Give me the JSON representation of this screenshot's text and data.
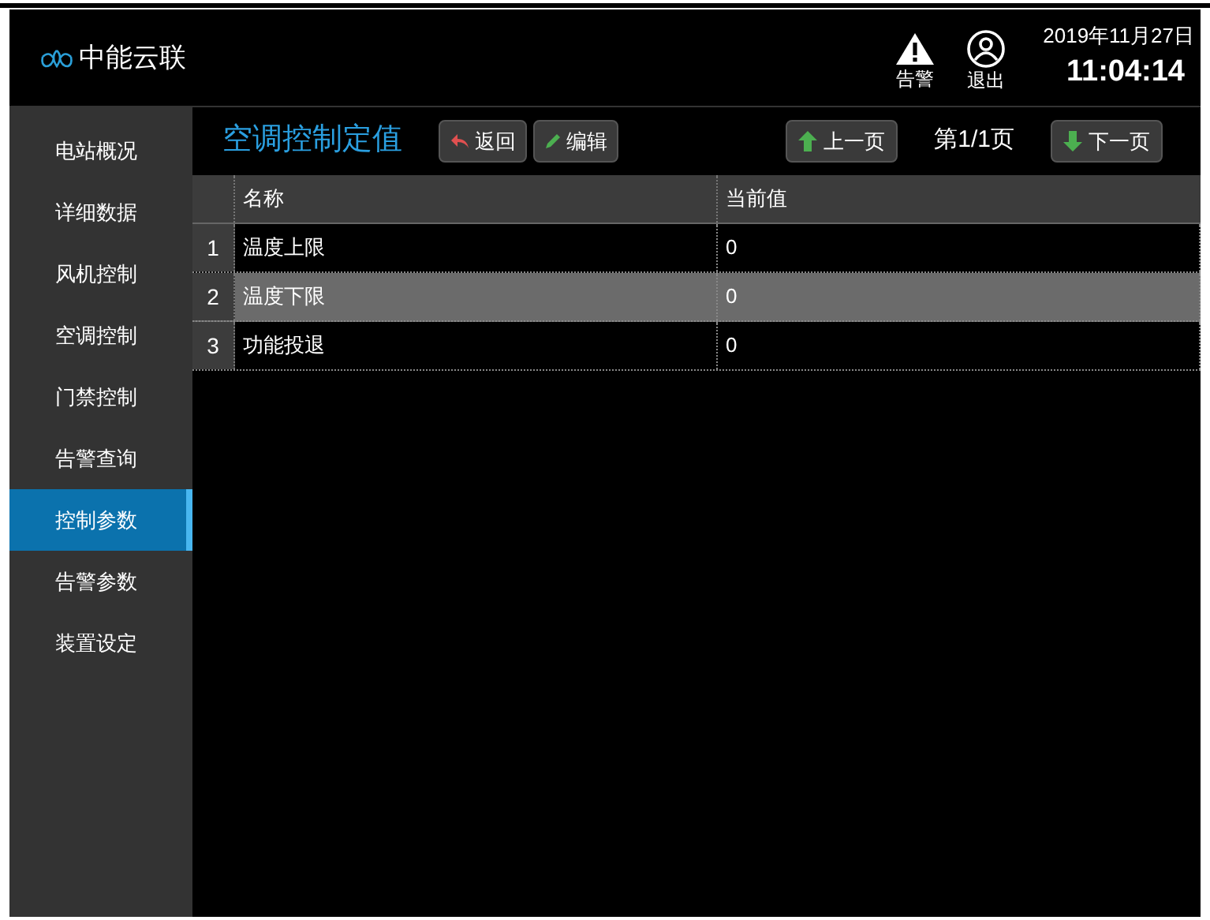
{
  "header": {
    "logo_text": "中能云联",
    "alarm_label": "告警",
    "logout_label": "退出",
    "date": "2019年11月27日",
    "time": "11:04:14"
  },
  "sidebar": {
    "items": [
      {
        "label": "电站概况",
        "selected": false
      },
      {
        "label": "详细数据",
        "selected": false
      },
      {
        "label": "风机控制",
        "selected": false
      },
      {
        "label": "空调控制",
        "selected": false
      },
      {
        "label": "门禁控制",
        "selected": false
      },
      {
        "label": "告警查询",
        "selected": false
      },
      {
        "label": "控制参数",
        "selected": true
      },
      {
        "label": "告警参数",
        "selected": false
      },
      {
        "label": "装置设定",
        "selected": false
      }
    ]
  },
  "toolbar": {
    "title": "空调控制定值",
    "back_button": "返回",
    "edit_button": "编辑",
    "prev_button": "上一页",
    "page_indicator": "第1/1页",
    "next_button": "下一页"
  },
  "table": {
    "columns": [
      "名称",
      "当前值"
    ],
    "rows": [
      {
        "index": "1",
        "name": "温度上限",
        "value": "0",
        "selected": false
      },
      {
        "index": "2",
        "name": "温度下限",
        "value": "0",
        "selected": true
      },
      {
        "index": "3",
        "name": "功能投退",
        "value": "0",
        "selected": false
      }
    ]
  }
}
